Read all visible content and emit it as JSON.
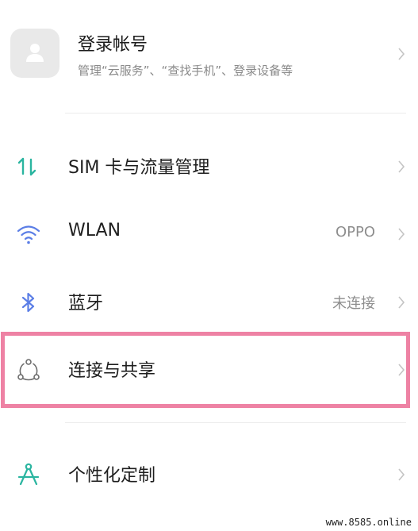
{
  "account": {
    "title": "登录帐号",
    "subtitle": "管理“云服务”、“查找手机”、登录设备等",
    "icon": "user-avatar-icon"
  },
  "settings": [
    {
      "label": "SIM 卡与流量管理",
      "value": "",
      "icon": "sim-traffic-icon"
    },
    {
      "label": "WLAN",
      "value": "OPPO",
      "icon": "wifi-icon"
    },
    {
      "label": "蓝牙",
      "value": "未连接",
      "icon": "bluetooth-icon"
    },
    {
      "label": "连接与共享",
      "value": "",
      "icon": "connection-share-icon"
    },
    {
      "label": "个性化定制",
      "value": "",
      "icon": "personalization-icon"
    }
  ],
  "colors": {
    "accent": "#2bb5a0",
    "wifi": "#5b7ee6",
    "highlight": "#ee82a4"
  },
  "watermark": "www.8585.online"
}
